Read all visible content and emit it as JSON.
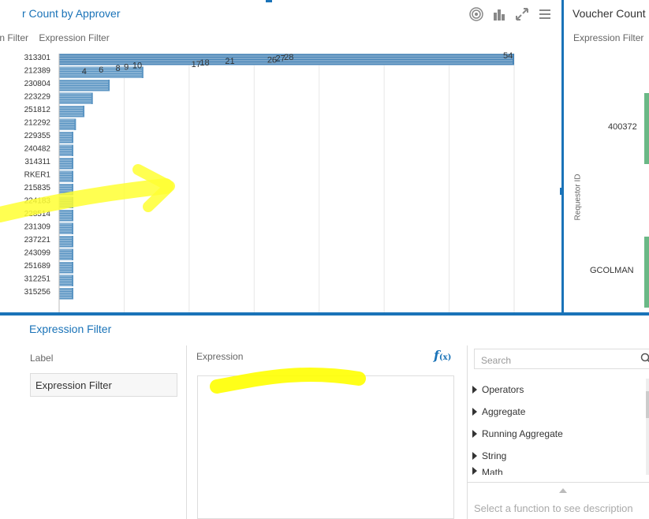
{
  "chart_panel": {
    "title": "r Count by Approver",
    "tabs": [
      "ion Filter",
      "Expression Filter"
    ]
  },
  "right_panel": {
    "title": "Voucher Count",
    "subtitle": "Expression Filter",
    "axis_label": "Requestor ID",
    "categories": [
      "400372",
      "GCOLMAN"
    ]
  },
  "editor": {
    "title": "Expression Filter",
    "label_heading": "Label",
    "label_value": "Expression Filter",
    "expression_heading": "Expression",
    "fx_glyph": "f",
    "fx_sub": "(x)"
  },
  "functions": {
    "search_placeholder": "Search",
    "items": [
      "Operators",
      "Aggregate",
      "Running Aggregate",
      "String",
      "Math"
    ],
    "description": "Select a function to see description"
  },
  "colors": {
    "accent": "#1a73b8",
    "bar": "#4a86b8",
    "right_bar": "#6ab886",
    "highlight": "#ffff00"
  },
  "chart_data": {
    "type": "bar",
    "orientation": "horizontal",
    "categories": [
      "313301",
      "212389",
      "230804",
      "223229",
      "251812",
      "212292",
      "229355",
      "240482",
      "314311",
      "RKER1",
      "215835",
      "224183",
      "228514",
      "231309",
      "237221",
      "243099",
      "251689",
      "312251",
      "315256"
    ],
    "values": [
      54,
      10,
      6,
      4,
      3,
      2,
      1,
      1,
      1,
      1,
      1,
      1,
      1,
      1,
      1,
      1,
      1,
      1,
      1
    ],
    "value_labels": [
      "54",
      "28",
      "27",
      "26",
      "21",
      "18",
      "17",
      "10",
      "9",
      "8",
      "6",
      "4"
    ],
    "label_values": [
      54,
      28,
      27,
      26,
      21,
      18,
      17,
      10,
      9,
      8,
      6,
      4
    ],
    "xlim": [
      0,
      54
    ],
    "grid": true
  }
}
